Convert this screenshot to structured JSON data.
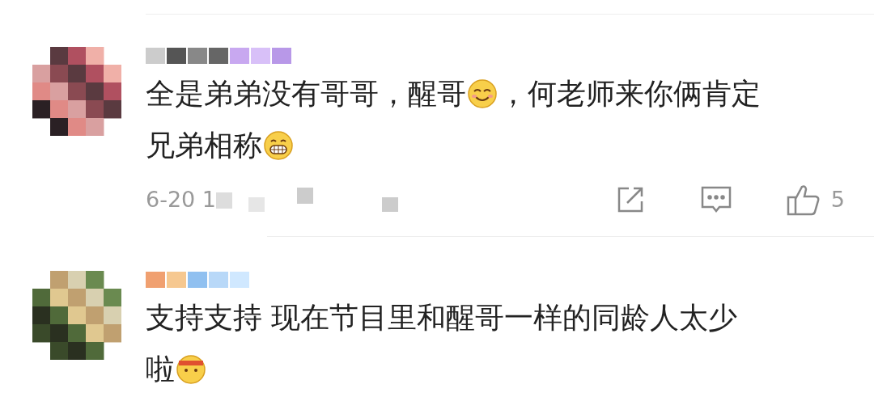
{
  "comments": [
    {
      "lines": [
        [
          {
            "kind": "text",
            "text": "全是弟弟没有哥哥，醒哥"
          },
          {
            "kind": "smile"
          },
          {
            "kind": "text",
            "text": "，何老师来你俩肯定"
          }
        ],
        [
          {
            "kind": "text",
            "text": "兄弟相称"
          },
          {
            "kind": "grin"
          }
        ]
      ],
      "time": "6-20 1",
      "likes": "5"
    },
    {
      "lines": [
        [
          {
            "kind": "text",
            "text": "支持支持 现在节目里和醒哥一样的同龄人太少"
          }
        ],
        [
          {
            "kind": "text",
            "text": "啦"
          },
          {
            "kind": "sweat"
          }
        ]
      ]
    }
  ]
}
